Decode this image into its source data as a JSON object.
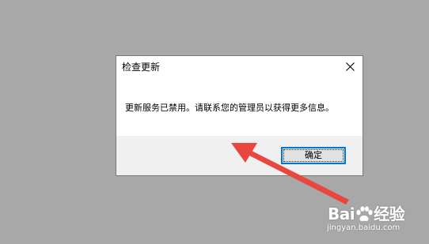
{
  "dialog": {
    "title": "检查更新",
    "message": "更新服务已禁用。请联系您的管理员以获得更多信息。",
    "ok_label": "确定",
    "close_icon": "close-icon"
  },
  "watermark": {
    "brand_prefix": "Bai",
    "brand_suffix": "经验",
    "url": "jingyan.baidu.com"
  },
  "colors": {
    "background": "#a8a8a8",
    "dialog_footer": "#f0f0f0",
    "button_focus_border": "#0078d7",
    "annotation_arrow": "#e8473f"
  }
}
